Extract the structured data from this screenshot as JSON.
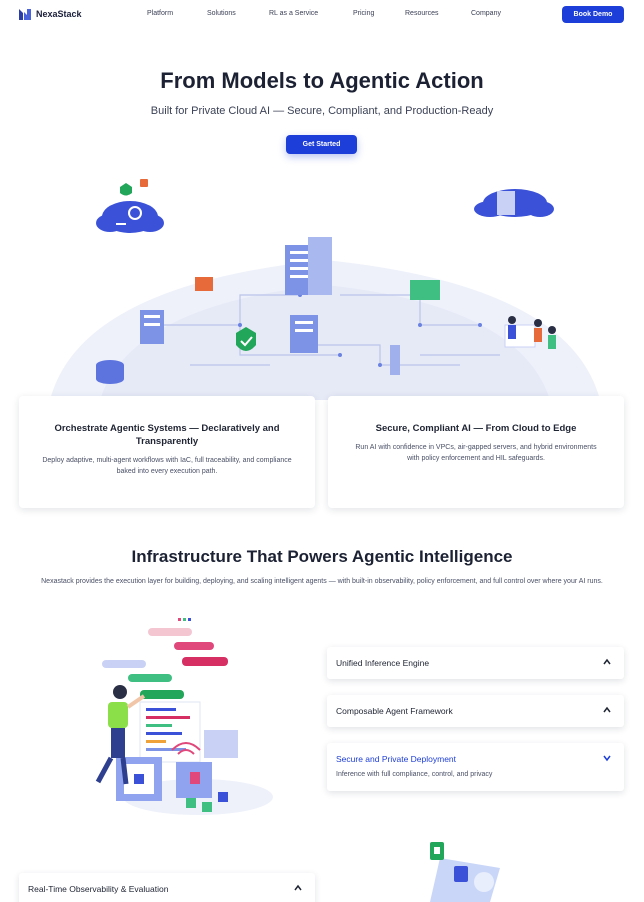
{
  "nav": {
    "brand": "NexaStack",
    "links": [
      "Platform",
      "Solutions",
      "RL as a Service",
      "Pricing",
      "Resources",
      "Company"
    ],
    "cta": "Book Demo"
  },
  "hero": {
    "title": "From Models to Agentic Action",
    "subtitle": "Built for Private Cloud AI — Secure, Compliant, and Production-Ready",
    "cta": "Get Started"
  },
  "features": [
    {
      "title": "Orchestrate Agentic Systems — Declaratively and Transparently",
      "description": "Deploy adaptive, multi-agent workflows with IaC, full traceability, and compliance baked into every execution path."
    },
    {
      "title": "Secure, Compliant AI — From Cloud to Edge",
      "description": "Run AI with confidence in VPCs, air-gapped servers, and hybrid environments with policy enforcement and HIL safeguards."
    }
  ],
  "infra": {
    "title": "Infrastructure That Powers Agentic Intelligence",
    "description": "Nexastack provides the execution layer for building, deploying, and scaling intelligent agents — with built-in observability, policy enforcement, and full control over where your AI runs.",
    "accordion": [
      {
        "title": "Unified Inference Engine",
        "state": "collapsed"
      },
      {
        "title": "Composable Agent Framework",
        "state": "collapsed"
      },
      {
        "title": "Secure and Private Deployment",
        "state": "expanded",
        "body": "Inference with full compliance, control, and privacy"
      }
    ]
  },
  "observability": {
    "accordion_title": "Real-Time Observability & Evaluation"
  },
  "colors": {
    "primary": "#1d3ed8",
    "heading": "#1c2233",
    "text": "#4a5066"
  }
}
